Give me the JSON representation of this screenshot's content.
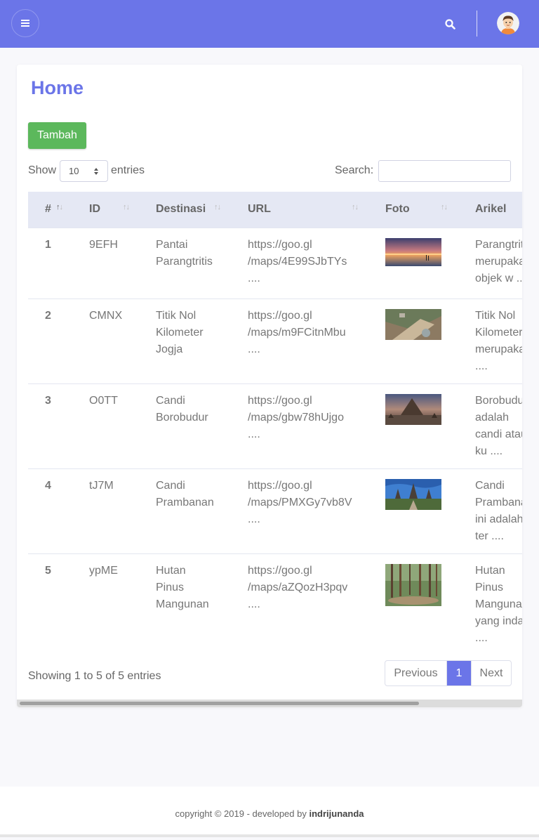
{
  "topbar": {
    "menu_icon": "hamburger-icon",
    "search_icon": "search-icon",
    "avatar": "user-avatar"
  },
  "page": {
    "title": "Home",
    "add_button": "Tambah"
  },
  "table_controls": {
    "show_label": "Show",
    "entries_label": "entries",
    "page_length": "10",
    "search_label": "Search:",
    "search_value": ""
  },
  "table": {
    "columns": [
      "#",
      "ID",
      "Destinasi",
      "URL",
      "Foto",
      "Arikel"
    ],
    "rows": [
      {
        "num": "1",
        "id": "9EFH",
        "dest": [
          "Pantai",
          "Parangtritis"
        ],
        "url": [
          "https://goo.gl",
          "/maps/4E99SJbTYs",
          "...."
        ],
        "foto": "sunset-beach-photo",
        "art": [
          "Parangtritis",
          "merupakan",
          "objek w ...."
        ]
      },
      {
        "num": "2",
        "id": "CMNX",
        "dest": [
          "Titik Nol",
          "Kilometer",
          "Jogja"
        ],
        "url": [
          "https://goo.gl",
          "/maps/m9FCitnMbu",
          "...."
        ],
        "foto": "city-square-photo",
        "art": [
          "Titik Nol",
          "Kilometer",
          "merupakan",
          "...."
        ]
      },
      {
        "num": "3",
        "id": "O0TT",
        "dest": [
          "Candi",
          "Borobudur"
        ],
        "url": [
          "https://goo.gl",
          "/maps/gbw78hUjgo",
          "...."
        ],
        "foto": "temple-panorama-photo",
        "art": [
          "Borobudur",
          "adalah",
          "candi atau",
          "ku ...."
        ]
      },
      {
        "num": "4",
        "id": "tJ7M",
        "dest": [
          "Candi",
          "Prambanan"
        ],
        "url": [
          "https://goo.gl",
          "/maps/PMXGy7vb8V",
          "...."
        ],
        "foto": "temple-sky-photo",
        "art": [
          "Candi",
          "Prambanan",
          "ini adalah",
          "ter ...."
        ]
      },
      {
        "num": "5",
        "id": "ypME",
        "dest": [
          "Hutan",
          "Pinus",
          "Mangunan"
        ],
        "url": [
          "https://goo.gl",
          "/maps/aZQozH3pqv",
          "...."
        ],
        "foto": "pine-forest-photo",
        "art": [
          "Hutan",
          "Pinus",
          "Mangunan",
          "yang indah",
          "...."
        ]
      }
    ]
  },
  "pagination": {
    "info": "Showing 1 to 5 of 5 entries",
    "previous": "Previous",
    "current": "1",
    "next": "Next"
  },
  "footer": {
    "text": "copyright © 2019 - developed by",
    "author": "indrijunanda"
  },
  "colors": {
    "primary": "#6b75e8",
    "success": "#5cb85c",
    "table_head": "#e5e8f4"
  }
}
